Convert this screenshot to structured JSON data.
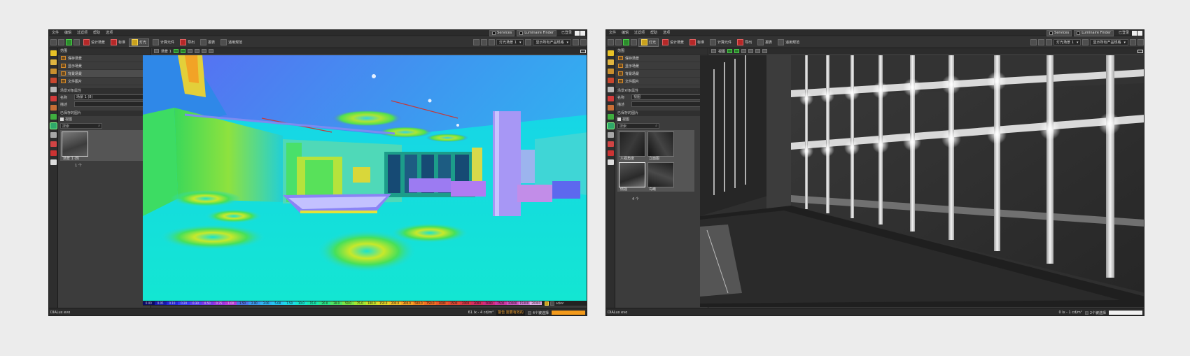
{
  "menu": [
    "文件",
    "编辑",
    "过滤项",
    "帮助",
    "选项"
  ],
  "services_label": "Services",
  "finder_label": "Luminaire Finder",
  "login_label": "已登录",
  "left_window": {
    "toolbar_tabs": [
      "设计场景",
      "标准",
      "灯光",
      "计算元件",
      "导出",
      "报表",
      "适用规范"
    ],
    "toolbar_active": "灯光",
    "light_scene_select": "灯光场景 1",
    "filter_select": "显示所有产品规格",
    "panel": {
      "header": "范围",
      "layers": [
        {
          "label": "保存场景",
          "selected": false
        },
        {
          "label": "显示场景",
          "selected": false
        },
        {
          "label": "背景场景",
          "selected": true
        },
        {
          "label": "文件图片",
          "selected": false
        }
      ],
      "props_header": "场景对象属性",
      "name_label": "名称",
      "name_value": "场景 1 (8)",
      "desc_label": "描述",
      "check_header": "已保存的图片",
      "check_label": "视图",
      "search_placeholder": "搜索",
      "thumbs": [
        {
          "label": "场景 1 (8)"
        }
      ],
      "count_label": "1 个"
    },
    "view_label": "场景 1",
    "legend": {
      "units": "cd/m²",
      "values": [
        "0.00",
        "0.05",
        "0.10",
        "0.20",
        "0.30",
        "0.50",
        "0.75",
        "1.00",
        "1.50",
        "2.00",
        "3.00",
        "5.00",
        "7.50",
        "10.0",
        "15.0",
        "20.0",
        "30.0",
        "50.0",
        "75.0",
        "100.0",
        "150.0",
        "200.0",
        "300.0",
        "500.0",
        "750.0",
        "1000",
        "1500",
        "2000",
        "3000",
        "5000",
        "7500",
        "10000",
        "15000",
        "20000"
      ],
      "colors": [
        "#0b0b66",
        "#1a1aa8",
        "#2828d6",
        "#3b3bf0",
        "#5a3ff0",
        "#7a3ae8",
        "#9a36de",
        "#b53ad8",
        "#4e74e4",
        "#3b98ec",
        "#30b2f0",
        "#25c6f2",
        "#1dd9e6",
        "#16e3cc",
        "#18e6ad",
        "#2ae58a",
        "#4de365",
        "#7ae446",
        "#a3e433",
        "#c6e02a",
        "#e4d62a",
        "#f2bd2a",
        "#f5a326",
        "#f68b22",
        "#f06f24",
        "#e85a2a",
        "#e24a34",
        "#dc3a48",
        "#d42e62",
        "#cf2d80",
        "#cc3aa3",
        "#cd57c2",
        "#d27fd9",
        "#e2aee8"
      ]
    },
    "status": {
      "app": "DIALux evo",
      "units": "61 lx - 4 cd/m²",
      "warning": "警告 需要有效的",
      "selection": "4个被选择"
    },
    "palette": {
      "top_left": "#1f5bc6",
      "mid": "#27d8e2",
      "green": "#3ee15a",
      "floor": "#18e4d8",
      "ceiling": "#4a6cf0",
      "yellow": "#d8e636",
      "purple": "#9c7bf2"
    }
  },
  "right_window": {
    "toolbar_tabs": [
      "设计场景",
      "标准",
      "灯光",
      "计算元件",
      "导出",
      "报表",
      "适用规范"
    ],
    "toolbar_active": "灯光",
    "light_scene_select": "灯光场景 1",
    "filter_select": "显示所有产品规格",
    "panel": {
      "header": "范围",
      "layers": [
        {
          "label": "保存场景",
          "selected": false
        },
        {
          "label": "显示场景",
          "selected": false
        },
        {
          "label": "背景场景",
          "selected": false
        },
        {
          "label": "文件图片",
          "selected": false
        }
      ],
      "props_header": "场景对象属性",
      "name_label": "名称",
      "name_value": "视图",
      "desc_label": "描述",
      "check_header": "已保存的图片",
      "check_label": "视图",
      "search_placeholder": "搜索",
      "thumbs": [
        {
          "label": "人视角度"
        },
        {
          "label": "立面图"
        },
        {
          "label": "侧视"
        },
        {
          "label": "鸟瞰"
        }
      ],
      "count_label": "4 个"
    },
    "view_label": "视图",
    "status": {
      "app": "DIALux evo",
      "units": "0 lx - 1 cd/m²",
      "selection": "2个被选择"
    }
  }
}
